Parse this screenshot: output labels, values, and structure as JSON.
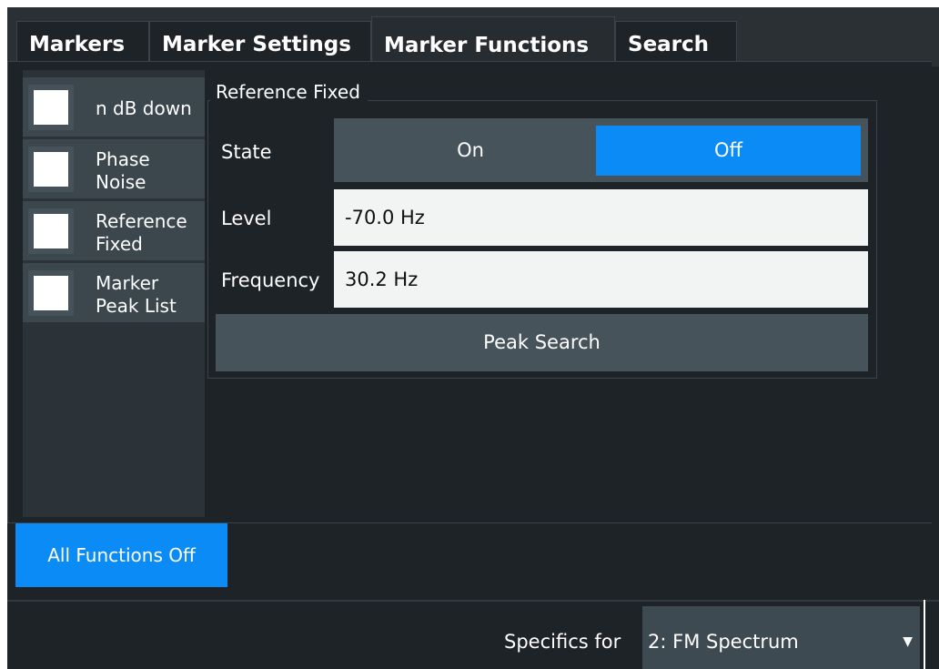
{
  "tabs": [
    {
      "label": "Markers"
    },
    {
      "label": "Marker Settings"
    },
    {
      "label": "Marker Functions"
    },
    {
      "label": "Search"
    }
  ],
  "functions": [
    {
      "label": "n dB down"
    },
    {
      "label": "Phase\nNoise"
    },
    {
      "label": "Reference\nFixed"
    },
    {
      "label": "Marker\nPeak List"
    }
  ],
  "group": {
    "title": "Reference Fixed",
    "state_label": "State",
    "state_on": "On",
    "state_off": "Off",
    "state_selected": "Off",
    "level_label": "Level",
    "level_value": "-70.0 Hz",
    "frequency_label": "Frequency",
    "frequency_value": "30.2 Hz",
    "peak_search": "Peak Search"
  },
  "all_off_label": "All Functions Off",
  "specifics": {
    "label": "Specifics for",
    "selected": "2: FM Spectrum"
  },
  "colors": {
    "accent": "#0a8bf5",
    "background": "#1e2327"
  }
}
